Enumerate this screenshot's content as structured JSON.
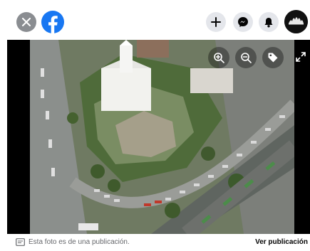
{
  "header": {
    "close_icon": "close-icon",
    "logo_icon": "facebook-logo-icon",
    "create_icon": "plus-icon",
    "messenger_icon": "messenger-icon",
    "notifications_icon": "bell-icon",
    "avatar_text": "",
    "colors": {
      "round_button_bg": "#e4e6eb",
      "close_bg": "#8a8d91",
      "brand": "#1877f2"
    }
  },
  "viewer": {
    "zoom_in_icon": "zoom-in-icon",
    "zoom_out_icon": "zoom-out-icon",
    "tag_icon": "tag-icon",
    "expand_icon": "expand-icon",
    "photo_description": "Aerial view of white temple with gardens and traffic"
  },
  "footer": {
    "info_text": "Esta foto es de una publicación.",
    "link_text": "Ver publicación"
  }
}
